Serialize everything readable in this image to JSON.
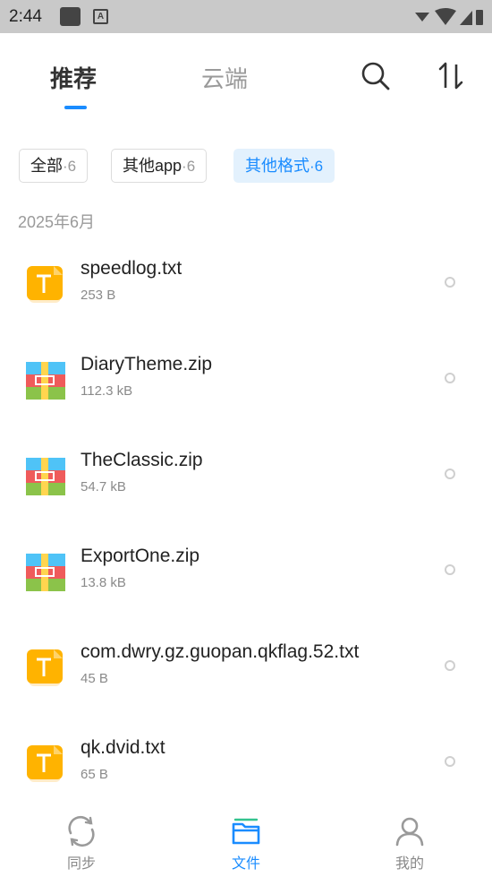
{
  "status_bar": {
    "time": "2:44"
  },
  "tabs": [
    {
      "label": "推荐",
      "active": true
    },
    {
      "label": "云端",
      "active": false
    }
  ],
  "toolbar": {
    "search_icon": "search-icon",
    "sort_icon": "sort-icon"
  },
  "filters": [
    {
      "label": "全部",
      "count": "·6"
    },
    {
      "label": "其他app",
      "count": "·6"
    },
    {
      "label": "其他格式",
      "count": "·6",
      "selected": true
    }
  ],
  "date_header": "2025年6月",
  "files": [
    {
      "name": "speedlog.txt",
      "size": "253 B",
      "type": "txt"
    },
    {
      "name": "DiaryTheme.zip",
      "size": "112.3 kB",
      "type": "zip"
    },
    {
      "name": "TheClassic.zip",
      "size": "54.7 kB",
      "type": "zip"
    },
    {
      "name": "ExportOne.zip",
      "size": "13.8 kB",
      "type": "zip"
    },
    {
      "name": "com.dwry.gz.guopan.qkflag.52.txt",
      "size": "45 B",
      "type": "txt"
    },
    {
      "name": "qk.dvid.txt",
      "size": "65 B",
      "type": "txt"
    }
  ],
  "bottom_nav": [
    {
      "label": "同步",
      "icon": "sync-icon"
    },
    {
      "label": "文件",
      "icon": "folder-icon",
      "active": true
    },
    {
      "label": "我的",
      "icon": "person-icon"
    }
  ],
  "colors": {
    "accent": "#1a8cff",
    "txt_icon": "#ffb300",
    "chip_selected_bg": "#e3f1fd"
  }
}
